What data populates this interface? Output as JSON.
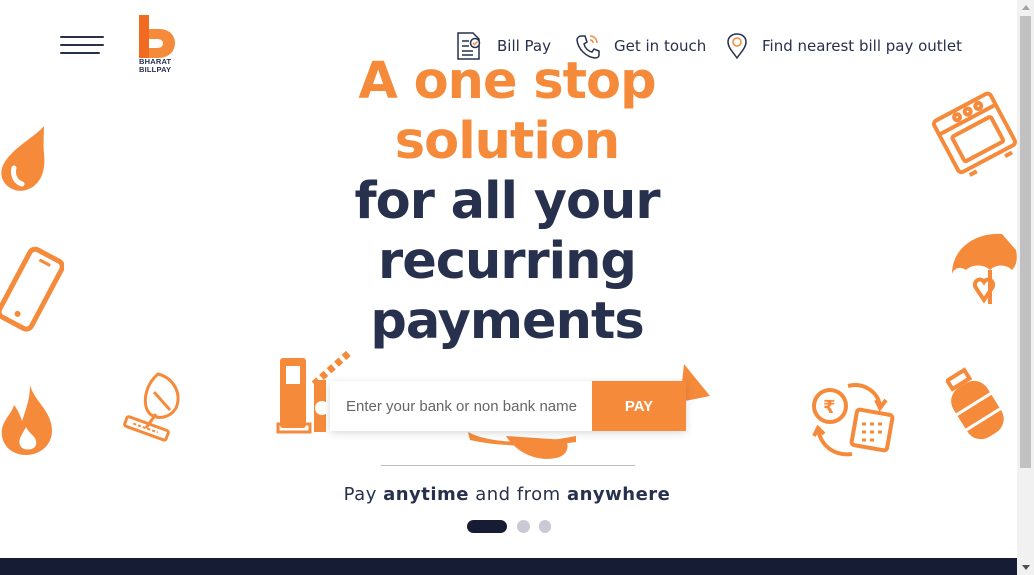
{
  "header": {
    "logo_text": "BHARAT BILLPAY",
    "nav": [
      {
        "label": "Bill Pay",
        "icon": "bill-document-icon"
      },
      {
        "label": "Get in touch",
        "icon": "phone-icon"
      },
      {
        "label": "Find nearest bill pay outlet",
        "icon": "location-pin-icon"
      }
    ]
  },
  "hero": {
    "line1": "A one stop",
    "line2": "solution",
    "line3": "for all your",
    "line4": "recurring",
    "line5": "payments"
  },
  "search": {
    "placeholder": "Enter your bank or non bank name",
    "button_label": "PAY"
  },
  "tagline": {
    "part1": "Pay ",
    "part2": "anytime",
    "part3": " and from ",
    "part4": "anywhere"
  },
  "carousel": {
    "slides": 3,
    "active_index": 0
  },
  "colors": {
    "brand_orange": "#f68a3b",
    "navy": "#27304d",
    "footer": "#151c33",
    "dot_inactive": "#c9cad6"
  },
  "decorative_icons": [
    "water-drop-icon",
    "mobile-phone-icon",
    "fire-flame-icon",
    "dish-antenna-icon",
    "fuel-pump-icon",
    "toll-barrier-icon",
    "airplane-icon",
    "oven-icon",
    "insurance-umbrella-icon",
    "rupee-payment-cycle-icon",
    "gas-cylinder-icon"
  ]
}
